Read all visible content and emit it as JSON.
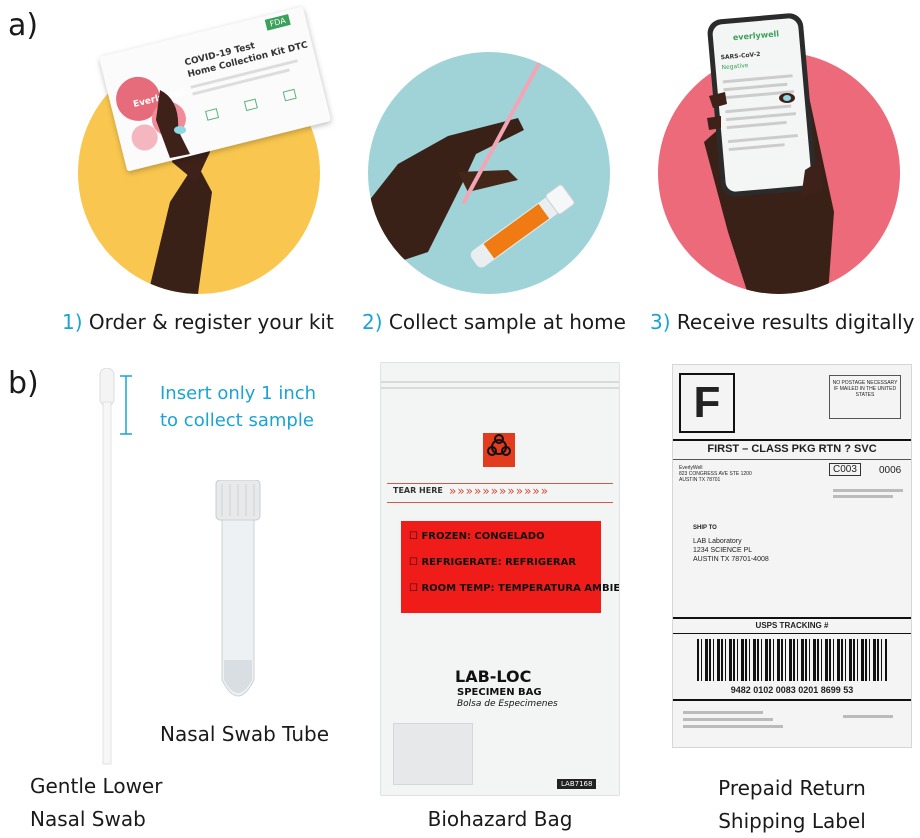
{
  "panel_a": {
    "label": "a)",
    "steps": [
      {
        "num": "1)",
        "text": "Order & register your kit"
      },
      {
        "num": "2)",
        "text": "Collect sample at home"
      },
      {
        "num": "3)",
        "text": "Receive results digitally"
      }
    ],
    "kit_card": {
      "brand": "EverlyWell",
      "title_line1": "COVID-19 Test",
      "title_line2": "Home Collection Kit DTC",
      "badge": "FDA"
    },
    "phone": {
      "app_name": "everlywell",
      "test_name": "SARS-CoV-2",
      "status": "Negative"
    },
    "colors": {
      "circle1": "#f9c74f",
      "circle2": "#9fd3d8",
      "circle3": "#ec6a7a",
      "accent": "#1ba3d6"
    }
  },
  "panel_b": {
    "label": "b)",
    "swab_hint_line1": "Insert only 1 inch",
    "swab_hint_line2": "to collect sample",
    "tube_label": "Nasal Swab Tube",
    "swab_caption_line1": "Gentle Lower",
    "swab_caption_line2": "Nasal Swab",
    "bag_caption": "Biohazard Bag",
    "label_caption_line1": "Prepaid Return",
    "label_caption_line2": "Shipping Label",
    "bag": {
      "tear_here": "TEAR HERE",
      "options": [
        "FROZEN: CONGELADO",
        "REFRIGERATE: REFRIGERAR",
        "ROOM TEMP: TEMPERATURA AMBIENTE"
      ],
      "brand": "LAB-LOC",
      "sub1": "SPECIMEN BAG",
      "sub2": "Bolsa de Especimenes",
      "code": "LAB7168"
    },
    "shipping_label": {
      "class_letter": "F",
      "postage_box": "NO POSTAGE NECESSARY IF MAILED IN THE UNITED STATES",
      "service": "FIRST – CLASS PKG RTN ? SVC",
      "sender_line1": "EverlyWell",
      "sender_line2": "823 CONGRESS AVE STE 1200",
      "sender_line3": "AUSTIN TX 78701",
      "code": "C003",
      "code2": "0006",
      "ship_to": "SHIP TO",
      "addr1": "LAB Laboratory",
      "addr2": "1234 SCIENCE PL",
      "addr3": "AUSTIN TX 78701-4008",
      "tracking_title": "USPS TRACKING #",
      "tracking_number": "9482 0102 0083 0201 8699 53"
    }
  }
}
